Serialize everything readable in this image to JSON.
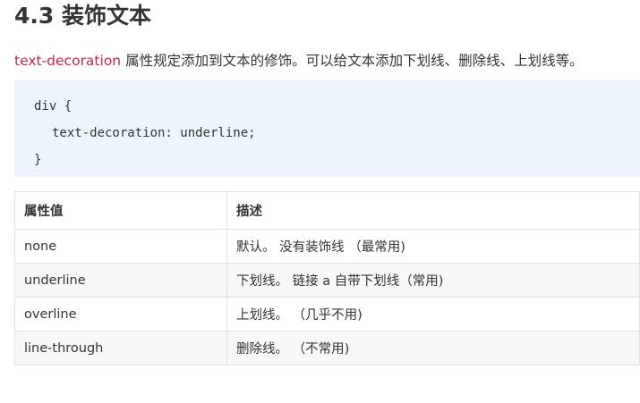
{
  "section": {
    "title": "4.3 装饰文本"
  },
  "intro": {
    "keyword": "text-decoration",
    "text": " 属性规定添加到文本的修饰。可以给文本添加下划线、删除线、上划线等。"
  },
  "code": {
    "line1": "div {",
    "line2": "text-decoration: underline;",
    "line3": "}"
  },
  "table": {
    "headers": [
      "属性值",
      "描述"
    ],
    "rows": [
      [
        "none",
        "默认。 没有装饰线 （最常用)"
      ],
      [
        "underline",
        "下划线。 链接 a 自带下划线（常用)"
      ],
      [
        "overline",
        "上划线。 （几乎不用)"
      ],
      [
        "line-through",
        "删除线。 （不常用)"
      ]
    ]
  }
}
